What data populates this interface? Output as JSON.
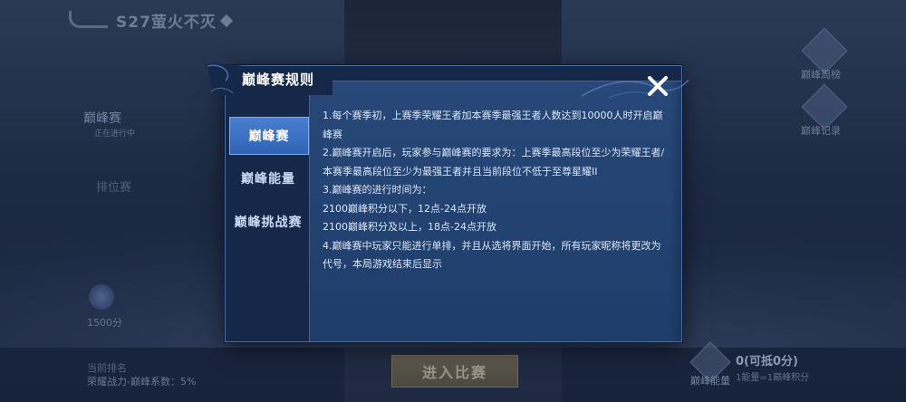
{
  "background": {
    "season_title": "S27萤火不灭",
    "modes": {
      "peak": "巅峰赛",
      "peak_status": "正在进行中",
      "ranked": "排位赛"
    },
    "score": "1500分",
    "current_rank": "当前排名",
    "rank_info": "荣耀战力-巅峰系数：5%",
    "enter_button": "进入比赛",
    "right_menu": [
      {
        "label": "巅峰周榜"
      },
      {
        "label": "巅峰记录"
      }
    ],
    "peak_energy": {
      "label": "巅峰能量",
      "count": "0(可抵0分)",
      "rule": "1能量=1巅峰积分"
    }
  },
  "modal": {
    "title": "巅峰赛规则",
    "close_icon": "close-icon",
    "tabs": [
      {
        "label": "巅峰赛",
        "active": true
      },
      {
        "label": "巅峰能量",
        "active": false
      },
      {
        "label": "巅峰挑战赛",
        "active": false
      }
    ],
    "rules": [
      "1.每个赛季初，上赛季荣耀王者加本赛季最强王者人数达到10000人时开启巅峰赛",
      "2.巅峰赛开启后，玩家参与巅峰赛的要求为：上赛季最高段位至少为荣耀王者/本赛季最高段位至少为最强王者并且当前段位不低于至尊星耀II",
      "3.巅峰赛的进行时间为：",
      "2100巅峰积分以下，12点-24点开放",
      "2100巅峰积分及以上，18点-24点开放",
      "4.巅峰赛中玩家只能进行单排，并且从选将界面开始，所有玩家昵称将更改为代号，本局游戏结束后显示"
    ]
  },
  "colors": {
    "modal_bg": "#16284a",
    "content_bg": "#274878",
    "active_tab": "#3f75c8",
    "text": "#dbe6f7"
  }
}
